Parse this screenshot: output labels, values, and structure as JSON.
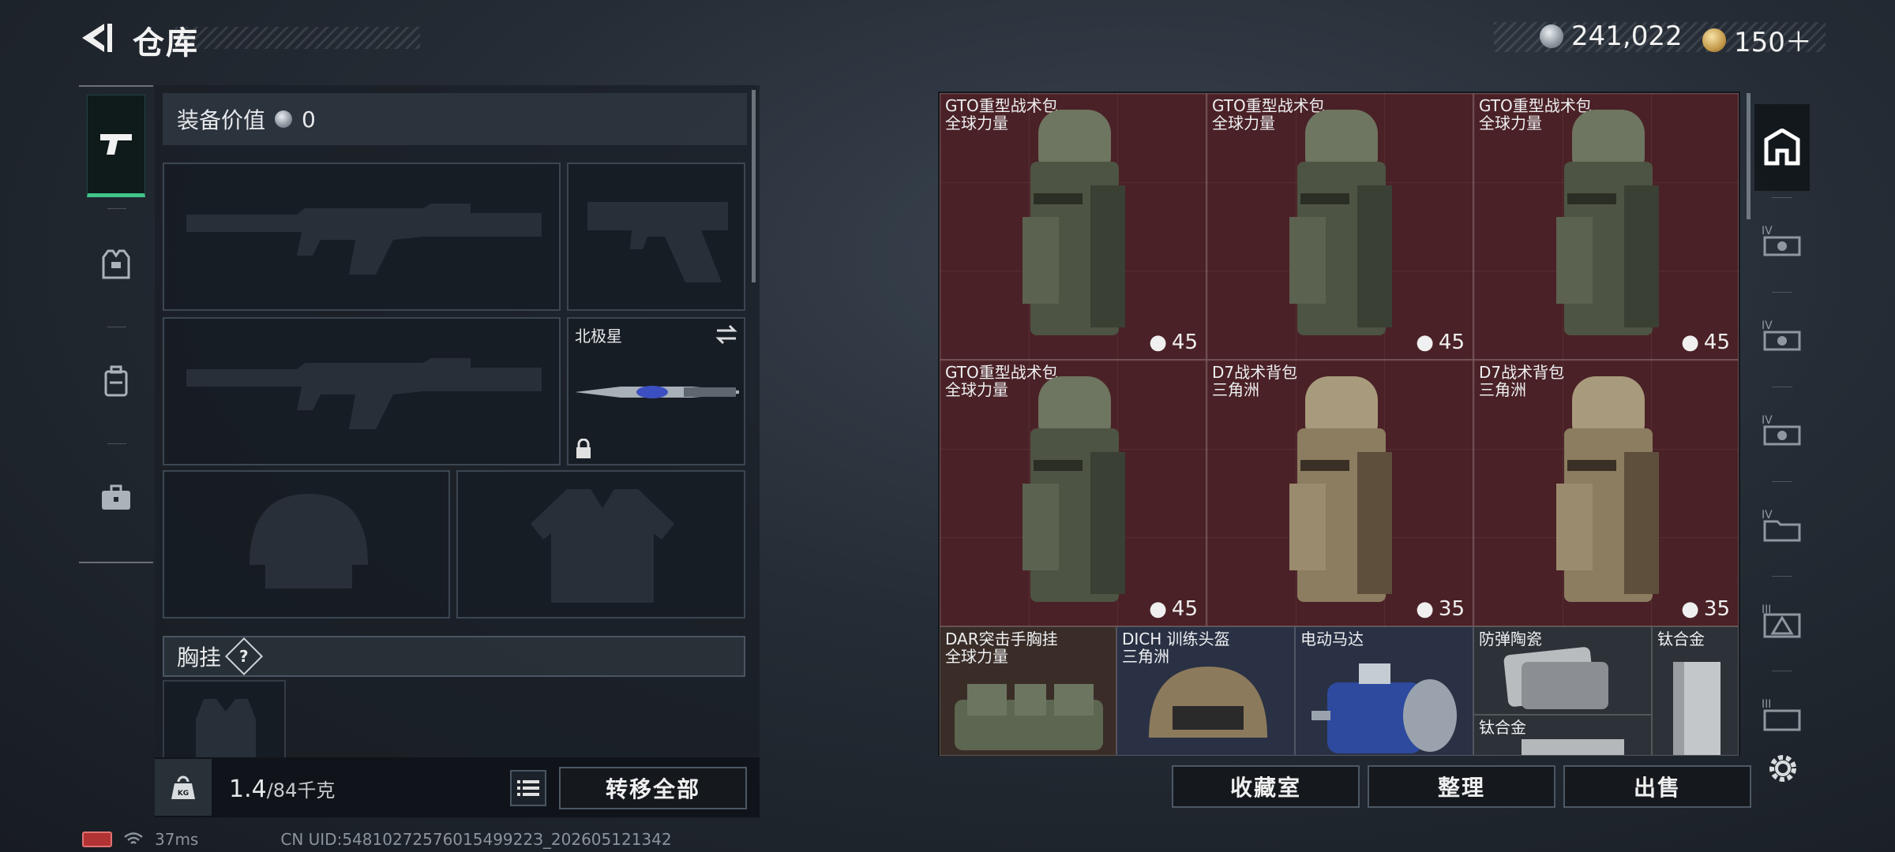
{
  "header": {
    "title": "仓库",
    "currency_silver": "241,022",
    "currency_gold": "150＋"
  },
  "left_tabs": [
    {
      "name": "weapons",
      "icon": "gun-icon",
      "active": true
    },
    {
      "name": "armor",
      "icon": "vest-icon",
      "active": false
    },
    {
      "name": "backpack",
      "icon": "backpack-icon",
      "active": false
    },
    {
      "name": "case",
      "icon": "briefcase-icon",
      "active": false
    }
  ],
  "equipment": {
    "value_label": "装备价值",
    "value": "0",
    "melee_name": "北极星",
    "chest_rig_label": "胸挂",
    "chest_rig_help": "?"
  },
  "capacity": {
    "used": "1.4",
    "max": "/84千克"
  },
  "buttons": {
    "transfer_all": "转移全部",
    "collection": "收藏室",
    "organize": "整理",
    "sell": "出售"
  },
  "grid_items": [
    {
      "name": "GTO重型战术包",
      "sub": "全球力量",
      "cap": "45"
    },
    {
      "name": "GTO重型战术包",
      "sub": "全球力量",
      "cap": "45"
    },
    {
      "name": "GTO重型战术包",
      "sub": "全球力量",
      "cap": "45"
    },
    {
      "name": "GTO重型战术包",
      "sub": "全球力量",
      "cap": "45"
    },
    {
      "name": "D7战术背包",
      "sub": "三角洲",
      "cap": "35"
    },
    {
      "name": "D7战术背包",
      "sub": "三角洲",
      "cap": "35"
    },
    {
      "name": "DAR突击手胸挂",
      "sub": "全球力量"
    },
    {
      "name": "DICH 训练头盔",
      "sub": "三角洲"
    },
    {
      "name": "电动马达",
      "sub": ""
    },
    {
      "name": "防弹陶瓷",
      "sub": ""
    },
    {
      "name": "钛合金",
      "sub": ""
    },
    {
      "name": "钛合金",
      "sub": ""
    }
  ],
  "right_rail": [
    "home-icon",
    "tier4-scope-icon",
    "tier4-scope-icon",
    "tier4-scope-icon",
    "tier4-folder-icon",
    "tier3-triangle-icon",
    "tier3-box-icon",
    "gear-icon"
  ],
  "rail_labels": [
    "IV",
    "IV",
    "IV",
    "IV",
    "III",
    "III"
  ],
  "status": {
    "ping": "37ms",
    "uid": "CN UID:5481027257601549922З_202605121342"
  },
  "colors": {
    "accent_green": "#3fc58a",
    "rare_red": "#4a2126"
  }
}
